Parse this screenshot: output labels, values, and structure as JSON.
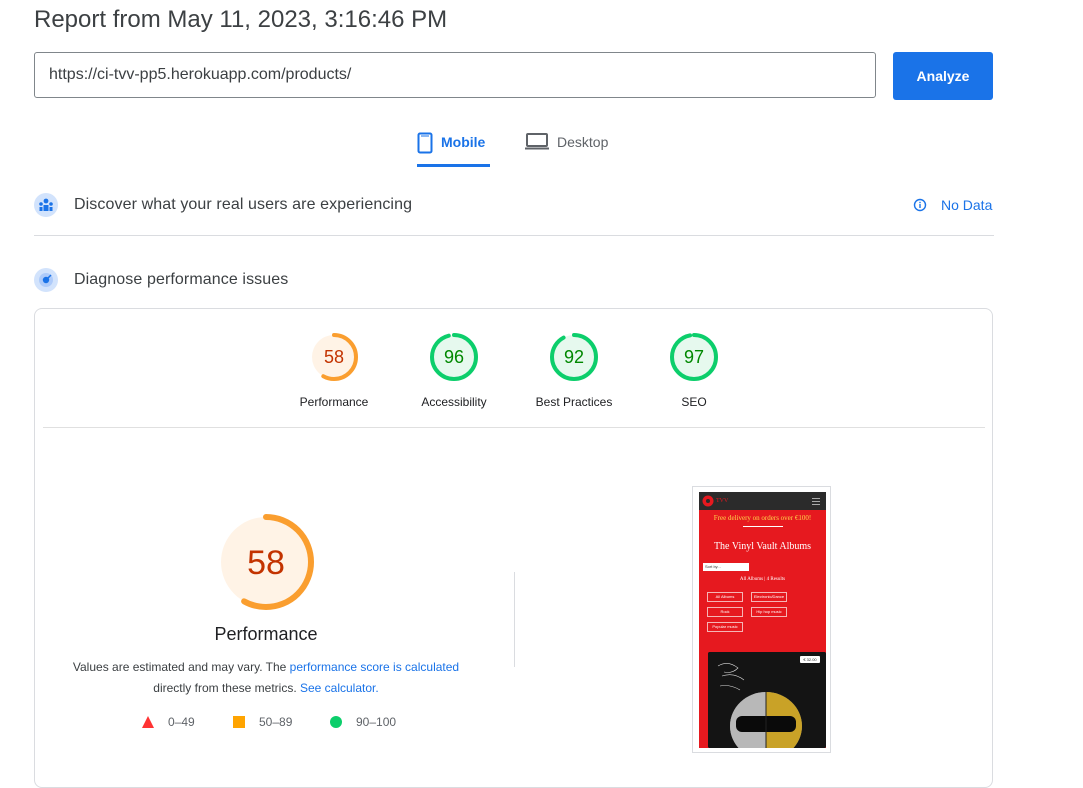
{
  "report": {
    "title": "Report from May 11, 2023, 3:16:46 PM"
  },
  "search": {
    "url": "https://ci-tvv-pp5.herokuapp.com/products/",
    "analyze_label": "Analyze"
  },
  "tabs": [
    {
      "label": "Mobile"
    },
    {
      "label": "Desktop"
    }
  ],
  "field_data": {
    "heading": "Discover what your real users are experiencing",
    "status": "No Data"
  },
  "lab_data": {
    "heading": "Diagnose performance issues"
  },
  "scores": [
    {
      "label": "Performance",
      "value": 58,
      "color": "#fa9e2f",
      "fill": "#fff3e6",
      "text_color": "#c33300"
    },
    {
      "label": "Accessibility",
      "value": 96,
      "color": "#0cce6b",
      "fill": "#e6f9ee",
      "text_color": "#008800"
    },
    {
      "label": "Best Practices",
      "value": 92,
      "color": "#0cce6b",
      "fill": "#e6f9ee",
      "text_color": "#008800"
    },
    {
      "label": "SEO",
      "value": 97,
      "color": "#0cce6b",
      "fill": "#e6f9ee",
      "text_color": "#008800"
    }
  ],
  "main_gauge": {
    "value": "58",
    "label": "Performance"
  },
  "description": {
    "prefix": "Values are estimated and may vary. The ",
    "link1": "performance score is calculated",
    "middle": "directly from these metrics. ",
    "link2": "See calculator."
  },
  "legend": [
    {
      "range": "0–49",
      "color": "#ff3333"
    },
    {
      "range": "50–89",
      "color": "#ffa400"
    },
    {
      "range": "90–100",
      "color": "#0cce6b"
    }
  ],
  "screenshot": {
    "logo_text": "TVV",
    "banner": "Free delivery on orders over €100!",
    "heading": "The Vinyl Vault Albums",
    "sort_placeholder": "Sort by...",
    "result_count": "All Albums | 4 Results",
    "filters": [
      "All Albums",
      "Electronic/Dance",
      "Rock",
      "Hip hop music",
      "Popular music"
    ],
    "price": "€ 32.00"
  }
}
